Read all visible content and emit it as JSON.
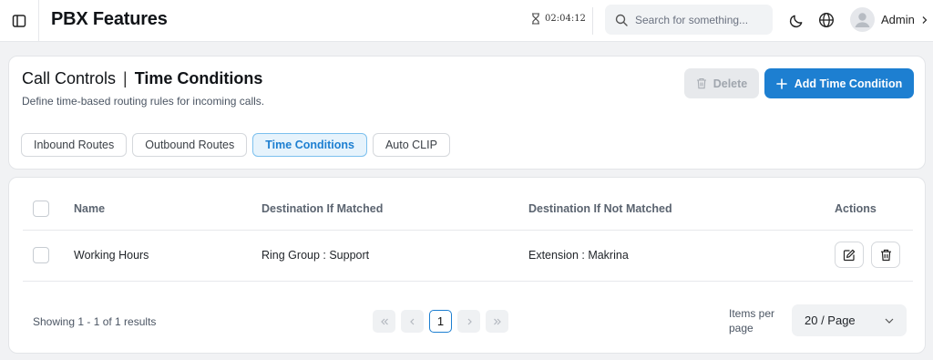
{
  "topbar": {
    "title": "PBX Features",
    "clock": "02:04:12",
    "search_placeholder": "Search for something...",
    "user_name": "Admin"
  },
  "header": {
    "breadcrumb_parent": "Call Controls",
    "separator": "|",
    "breadcrumb_current": "Time Conditions",
    "subtitle": "Define time-based routing rules for incoming calls.",
    "delete_label": "Delete",
    "add_label": "Add Time Condition"
  },
  "tabs": [
    {
      "label": "Inbound Routes",
      "active": false
    },
    {
      "label": "Outbound Routes",
      "active": false
    },
    {
      "label": "Time Conditions",
      "active": true
    },
    {
      "label": "Auto CLIP",
      "active": false
    }
  ],
  "table": {
    "columns": [
      "Name",
      "Destination If Matched",
      "Destination If Not Matched",
      "Actions"
    ],
    "rows": [
      {
        "name": "Working Hours",
        "matched": "Ring Group : Support",
        "not_matched": "Extension : Makrina"
      }
    ]
  },
  "pagination": {
    "showing": "Showing 1 - 1 of 1 results",
    "current_page": "1",
    "items_per_page_label": "Items per page",
    "page_size": "20 / Page"
  },
  "colors": {
    "primary": "#1d7fd1",
    "tab_active_bg": "#e6f3fc",
    "page_bg": "#f1f2f4"
  },
  "icons": {
    "sidebar": "sidebar-toggle-icon",
    "clock": "hourglass-icon",
    "search": "search-icon",
    "theme": "moon-icon",
    "language": "globe-icon",
    "edit": "edit-icon",
    "delete": "trash-icon"
  }
}
